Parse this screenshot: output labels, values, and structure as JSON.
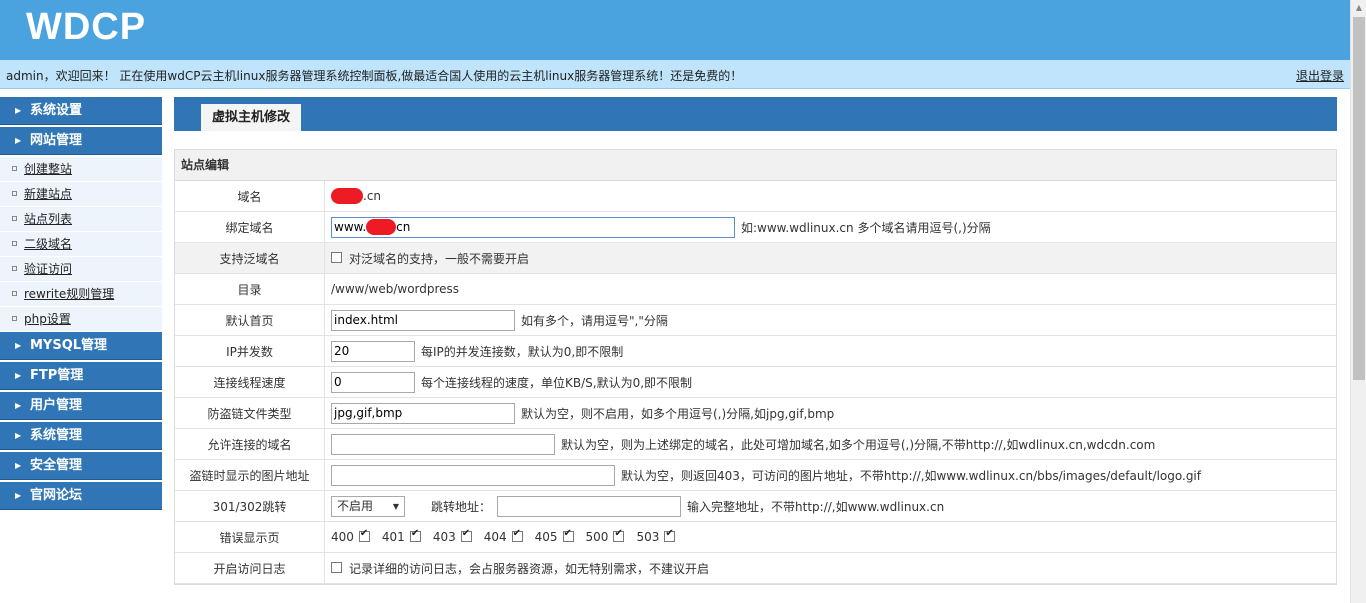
{
  "header": {
    "logo": "WDCP",
    "welcome": "admin，欢迎回来！ 正在使用wdCP云主机linux服务器管理系统控制面板,做最适合国人使用的云主机linux服务器管理系统！还是免费的！",
    "logout": "退出登录"
  },
  "sidebar": {
    "menus": [
      {
        "label": "系统设置"
      },
      {
        "label": "网站管理",
        "items": [
          "创建整站",
          "新建站点",
          "站点列表",
          "二级域名",
          "验证访问",
          "rewrite规则管理",
          "php设置"
        ]
      },
      {
        "label": "MYSQL管理"
      },
      {
        "label": "FTP管理"
      },
      {
        "label": "用户管理"
      },
      {
        "label": "系统管理"
      },
      {
        "label": "安全管理"
      },
      {
        "label": "官网论坛"
      }
    ]
  },
  "page": {
    "tab_title": "虚拟主机修改",
    "section": "站点编辑"
  },
  "form": {
    "domain": {
      "label": "域名",
      "value_suffix": ".cn"
    },
    "bind_domain": {
      "label": "绑定域名",
      "prefix": "www.",
      "suffix": "cn",
      "hint": "如:www.wdlinux.cn 多个域名请用逗号(,)分隔"
    },
    "wildcard": {
      "label": "支持泛域名",
      "text": "对泛域名的支持，一般不需要开启"
    },
    "directory": {
      "label": "目录",
      "value": "/www/web/wordpress"
    },
    "default_page": {
      "label": "默认首页",
      "value": "index.html",
      "hint": "如有多个，请用逗号\",\"分隔"
    },
    "ip_concurrency": {
      "label": "IP并发数",
      "value": "20",
      "hint": "每IP的并发连接数，默认为0,即不限制"
    },
    "thread_speed": {
      "label": "连接线程速度",
      "value": "0",
      "hint": "每个连接线程的速度，单位KB/S,默认为0,即不限制"
    },
    "hotlink_types": {
      "label": "防盗链文件类型",
      "value": "jpg,gif,bmp",
      "hint": "默认为空，则不启用，如多个用逗号(,)分隔,如jpg,gif,bmp"
    },
    "allowed_domains": {
      "label": "允许连接的域名",
      "value": "",
      "hint": "默认为空，则为上述绑定的域名，此处可增加域名,如多个用逗号(,)分隔,不带http://,如wdlinux.cn,wdcdn.com"
    },
    "hotlink_image": {
      "label": "盗链时显示的图片地址",
      "value": "",
      "hint": "默认为空，则返回403，可访问的图片地址，不带http://,如www.wdlinux.cn/bbs/images/default/logo.gif"
    },
    "redirect": {
      "label": "301/302跳转",
      "select_value": "不启用",
      "addr_label": "跳转地址：",
      "value": "",
      "hint": "输入完整地址，不带http://,如www.wdlinux.cn"
    },
    "error_pages": {
      "label": "错误显示页",
      "codes": [
        "400",
        "401",
        "403",
        "404",
        "405",
        "500",
        "503"
      ]
    },
    "access_log": {
      "label": "开启访问日志",
      "text": "记录详细的访问日志，会占服务器资源，如无特别需求，不建议开启"
    }
  },
  "colors": {
    "header": "#4aa3df",
    "menu": "#3076b6",
    "welcome_bar": "#bfe4fb",
    "redaction": "#ee1b24"
  }
}
